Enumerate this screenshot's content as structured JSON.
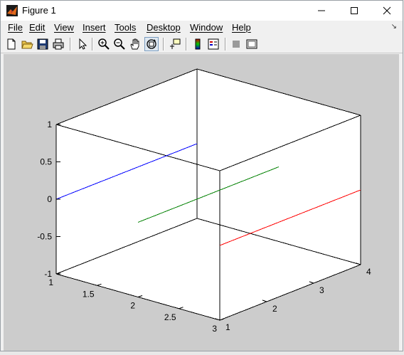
{
  "window": {
    "title": "Figure 1"
  },
  "menu": {
    "items": [
      "File",
      "Edit",
      "View",
      "Insert",
      "Tools",
      "Desktop",
      "Window",
      "Help"
    ]
  },
  "toolbar": {
    "icons": [
      "new-figure-icon",
      "open-file-icon",
      "save-icon",
      "print-icon",
      "edit-plot-icon",
      "zoom-in-icon",
      "zoom-out-icon",
      "pan-icon",
      "rotate-3d-icon",
      "data-cursor-icon",
      "colorbar-icon",
      "legend-icon",
      "hide-plot-tools-icon",
      "show-plot-tools-icon"
    ]
  },
  "chart_data": {
    "type": "line3d",
    "xlim": [
      1,
      3
    ],
    "ylim": [
      1,
      4
    ],
    "zlim": [
      -1,
      1
    ],
    "x_ticks": [
      "1",
      "1.5",
      "2",
      "2.5",
      "3"
    ],
    "y_ticks": [
      "1",
      "2",
      "3",
      "4"
    ],
    "z_ticks": [
      "-1",
      "-0.5",
      "0",
      "0.5",
      "1"
    ],
    "grid": false,
    "box": true,
    "series": [
      {
        "color": "#0000ff",
        "x": [
          1,
          1
        ],
        "y": [
          1,
          4
        ],
        "z": [
          0,
          0
        ]
      },
      {
        "color": "#008000",
        "x": [
          2,
          2
        ],
        "y": [
          1,
          4
        ],
        "z": [
          0,
          0
        ]
      },
      {
        "color": "#ff0000",
        "x": [
          3,
          3
        ],
        "y": [
          1,
          4
        ],
        "z": [
          0,
          0
        ]
      }
    ]
  }
}
